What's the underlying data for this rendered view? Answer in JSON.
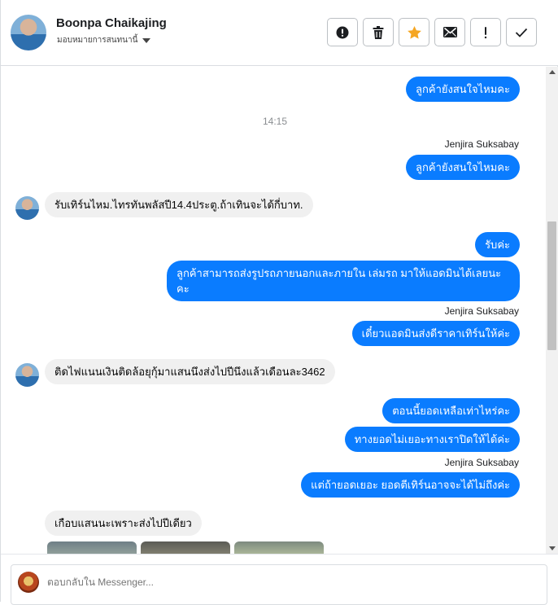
{
  "header": {
    "name": "Boonpa Chaikajing",
    "subtitle": "มอบหมายการสนทนานี้",
    "tools": [
      {
        "icon": "alert-circle-icon"
      },
      {
        "icon": "trash-icon"
      },
      {
        "icon": "star-icon"
      },
      {
        "icon": "envelope-icon"
      },
      {
        "icon": "exclamation-icon"
      },
      {
        "icon": "check-icon"
      }
    ]
  },
  "messages": {
    "m1": "ลูกค้ายังสนใจไหมคะ",
    "time1": "14:15",
    "sender1": "Jenjira Suksabay",
    "m2": "ลูกค้ายังสนใจไหมคะ",
    "in1": "รับเทิร์นไหม.ไทรทันพลัสปี14.4ประตู.ถ้าเทินจะได้กี่บาท.",
    "m3": "รับค่ะ",
    "m4_line1": "ลูกค้าสามารถส่งรูปรถภายนอกและภายใน เล่มรถ มาให้แอดมินได้เลยนะ",
    "m4_line2": "คะ",
    "sender2": "Jenjira Suksabay",
    "m5": "เดี๋ยวแอดมินส่งดีราคาเทิร์นให้ค่ะ",
    "in2": "ติดไฟแนนเงินติดล้อยุกุ้มาแสนนึงส่งไปปีนึงแล้วเดือนละ3462",
    "m6": "ตอนนี้ยอดเหลือเท่าไหร่คะ",
    "m7": "ทางยอดไม่เยอะทางเราปิดให้ได้ค่ะ",
    "sender3": "Jenjira Suksabay",
    "m8": "แต่ถ้ายอดเยอะ ยอดตีเทิร์นอาจจะได้ไม่ถึงค่ะ",
    "in3": "เกือบแสนนะเพราะส่งไปปีเดียว"
  },
  "composer": {
    "placeholder": "ตอบกลับใน Messenger..."
  },
  "colors": {
    "outgoing": "#0a7cff",
    "incoming": "#f0f0f0",
    "star": "#f5a623"
  }
}
